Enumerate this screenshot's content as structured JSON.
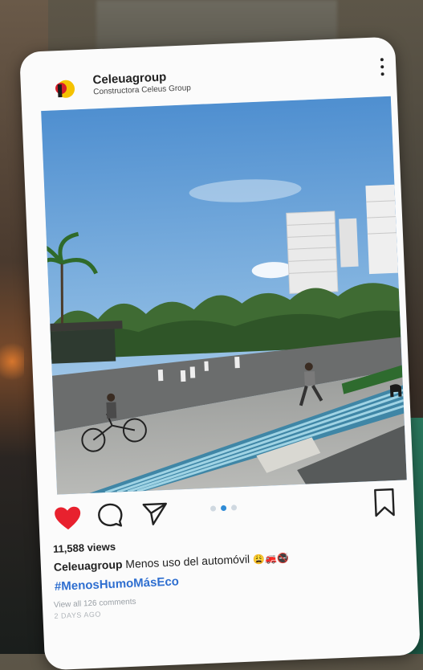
{
  "post": {
    "account_name": "Celeuagroup",
    "account_subtitle": "Constructora Celeus Group",
    "views": "11,588 views",
    "caption_user": "Celeuagroup",
    "caption_text": "Menos uso del automóvil",
    "caption_emojis": "😩🚒🚭",
    "hashtag": "#MenosHumoMásEco",
    "view_comments": "View all 126 comments",
    "time_ago": "2 DAYS AGO",
    "carousel_count": 3,
    "carousel_active": 2,
    "liked": true
  },
  "colors": {
    "like": "#e8212e",
    "hashtag": "#2f6fd0",
    "carousel_active": "#2f8bd6",
    "carousel_inactive": "#cfd8e0"
  },
  "icons": {
    "logo": "celeus-logo-icon",
    "more": "more-vertical-icon",
    "like": "heart-icon",
    "comment": "comment-icon",
    "share": "send-icon",
    "save": "bookmark-icon"
  }
}
